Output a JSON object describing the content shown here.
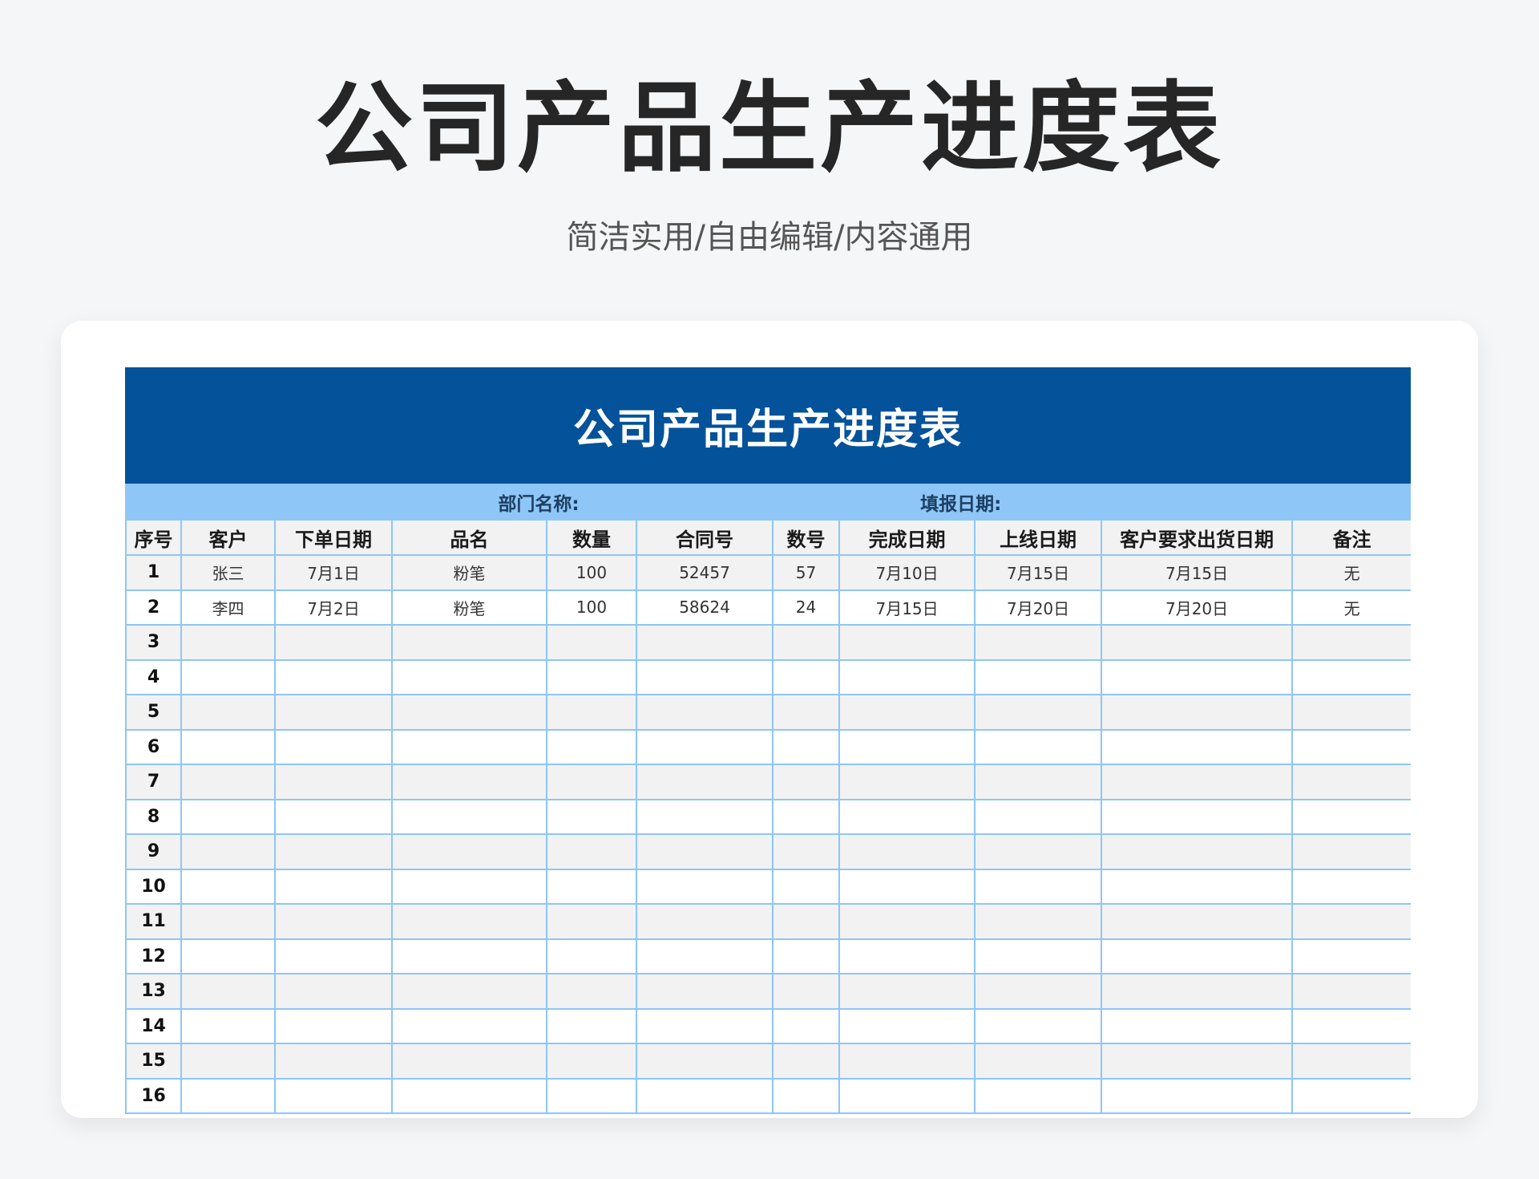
{
  "page": {
    "title": "公司产品生产进度表",
    "subtitle": "简洁实用/自由编辑/内容通用"
  },
  "sheet": {
    "title": "公司产品生产进度表",
    "department_label": "部门名称:",
    "date_label": "填报日期:",
    "columns": [
      "序号",
      "客户",
      "下单日期",
      "品名",
      "数量",
      "合同号",
      "数号",
      "完成日期",
      "上线日期",
      "客户要求出货日期",
      "备注"
    ],
    "rows": [
      [
        "1",
        "张三",
        "7月1日",
        "粉笔",
        "100",
        "52457",
        "57",
        "7月10日",
        "7月15日",
        "7月15日",
        "无"
      ],
      [
        "2",
        "李四",
        "7月2日",
        "粉笔",
        "100",
        "58624",
        "24",
        "7月15日",
        "7月20日",
        "7月20日",
        "无"
      ],
      [
        "3",
        "",
        "",
        "",
        "",
        "",
        "",
        "",
        "",
        "",
        ""
      ],
      [
        "4",
        "",
        "",
        "",
        "",
        "",
        "",
        "",
        "",
        "",
        ""
      ],
      [
        "5",
        "",
        "",
        "",
        "",
        "",
        "",
        "",
        "",
        "",
        ""
      ],
      [
        "6",
        "",
        "",
        "",
        "",
        "",
        "",
        "",
        "",
        "",
        ""
      ],
      [
        "7",
        "",
        "",
        "",
        "",
        "",
        "",
        "",
        "",
        "",
        ""
      ],
      [
        "8",
        "",
        "",
        "",
        "",
        "",
        "",
        "",
        "",
        "",
        ""
      ],
      [
        "9",
        "",
        "",
        "",
        "",
        "",
        "",
        "",
        "",
        "",
        ""
      ],
      [
        "10",
        "",
        "",
        "",
        "",
        "",
        "",
        "",
        "",
        "",
        ""
      ],
      [
        "11",
        "",
        "",
        "",
        "",
        "",
        "",
        "",
        "",
        "",
        ""
      ],
      [
        "12",
        "",
        "",
        "",
        "",
        "",
        "",
        "",
        "",
        "",
        ""
      ],
      [
        "13",
        "",
        "",
        "",
        "",
        "",
        "",
        "",
        "",
        "",
        ""
      ],
      [
        "14",
        "",
        "",
        "",
        "",
        "",
        "",
        "",
        "",
        "",
        ""
      ],
      [
        "15",
        "",
        "",
        "",
        "",
        "",
        "",
        "",
        "",
        "",
        ""
      ],
      [
        "16",
        "",
        "",
        "",
        "",
        "",
        "",
        "",
        "",
        "",
        ""
      ]
    ]
  },
  "colors": {
    "banner": "#03529a",
    "meta_row": "#8ec6f7",
    "grid": "#8ec6f7",
    "stripe": "#f2f2f2"
  }
}
